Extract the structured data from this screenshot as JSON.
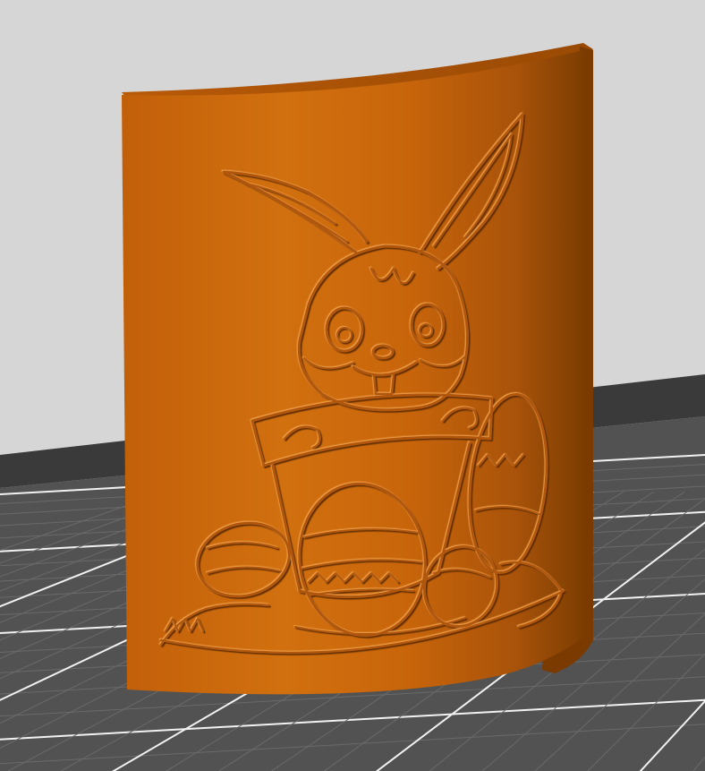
{
  "viewport": {
    "label": "",
    "colors": {
      "background": "#d6d6d6",
      "bed_band": "#3a3a3a",
      "bed_floor": "#555555",
      "bed_grid_minor": "#6a6a6a",
      "bed_grid_major": "#f2f2f2",
      "model_base": "#c9660c",
      "model_light": "#e58a2c",
      "model_dark": "#7a3a00",
      "model_top": "#a8540a"
    }
  },
  "model": {
    "kind": "curved-lithophane-relief-panel",
    "subject": "easter-bunny-in-flower-pot-with-eggs"
  }
}
